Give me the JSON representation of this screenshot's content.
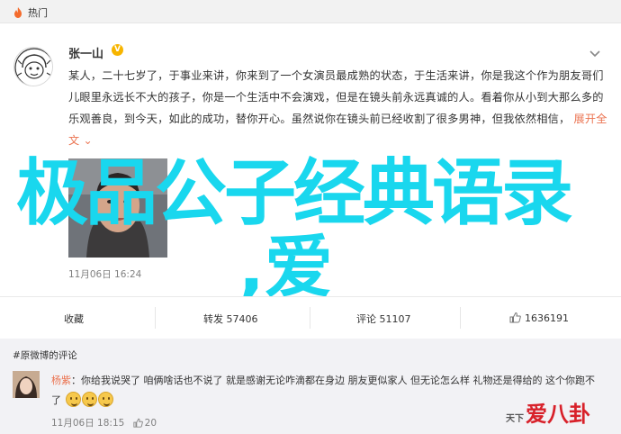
{
  "topbar": {
    "topic": "热门"
  },
  "post": {
    "author": "张一山",
    "verified": "V",
    "text_before_link": "某人，二十七岁了，于事业来讲，你来到了一个女演员最成熟的状态，于生活来讲，你是我这个作为朋友哥们儿眼里永远长不大的孩子，你是一个生活中不会演戏，但是在镜头前永远真诚的人。看着你从小到大那么多的乐观善良，到今天，如此的成功，替你开心。虽然说你在镜头前已经收割了很多男神，但我依然相信，",
    "link_text": "展开全文",
    "link_arrow": "⌄",
    "timestamp": "11月06日 16:24"
  },
  "overlay": {
    "title": "极品公子经典语录",
    "subtitle": ",爱"
  },
  "actions": {
    "collect": "收藏",
    "repost": "转发 57406",
    "comment": "评论 51107",
    "like": "1636191"
  },
  "comments": {
    "header": "#原微博的评论",
    "user": "杨紫",
    "text": "：你给我说哭了 咱俩啥话也不说了 就是感谢无论咋滴都在身边 朋友更似家人 但无论怎么样 礼物还是得给的 这个你跑不了",
    "meta_time": "11月06日 18:15",
    "meta_likes": "20"
  },
  "watermark": {
    "small": "天下",
    "big": "爱八卦"
  },
  "colors": {
    "accent": "#eb7350",
    "overlay": "#19d7ee",
    "verified": "#f7b500",
    "watermark": "#d8212a"
  },
  "icons": [
    "fire-icon",
    "chevron-down-icon",
    "thumb-up-icon",
    "like-small-icon"
  ]
}
